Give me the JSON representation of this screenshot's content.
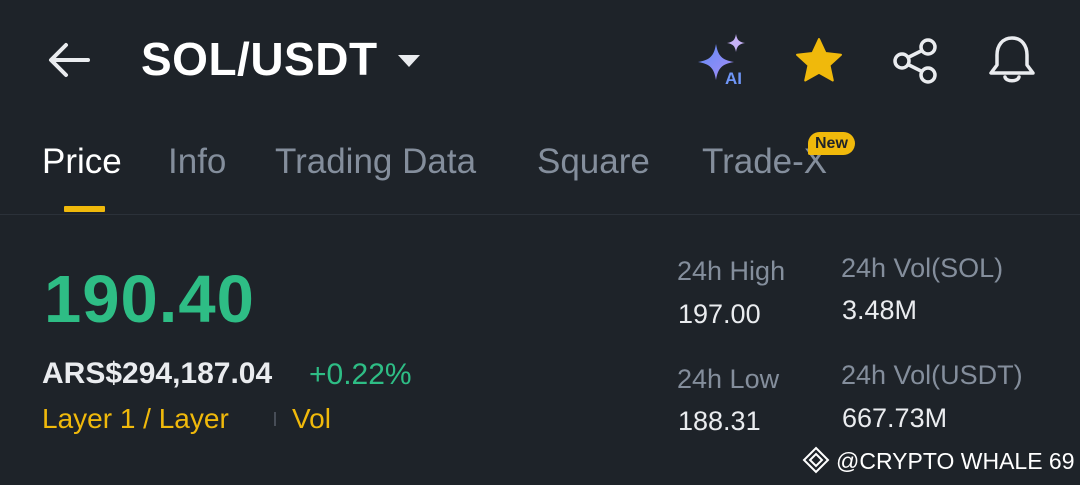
{
  "header": {
    "pair": "SOL/USDT",
    "ai_badge": "AI",
    "icons": [
      "back-arrow-icon",
      "chevron-down-icon",
      "ai-sparkle-icon",
      "star-icon",
      "share-icon",
      "bell-icon"
    ]
  },
  "tabs": [
    {
      "label": "Price",
      "active": true
    },
    {
      "label": "Info",
      "active": false
    },
    {
      "label": "Trading Data",
      "active": false
    },
    {
      "label": "Square",
      "active": false
    },
    {
      "label": "Trade-X",
      "active": false,
      "badge": "New"
    }
  ],
  "price": {
    "last": "190.40",
    "fiat": "ARS$294,187.04",
    "change": "+0.22%",
    "tag_category": "Layer 1 / Layer",
    "tag_vol": "Vol"
  },
  "stats": {
    "high_label": "24h High",
    "high_value": "197.00",
    "low_label": "24h Low",
    "low_value": "188.31",
    "vol_base_label": "24h Vol(SOL)",
    "vol_base_value": "3.48M",
    "vol_quote_label": "24h Vol(USDT)",
    "vol_quote_value": "667.73M"
  },
  "watermark": {
    "text": "@CRYPTO WHALE 69"
  },
  "colors": {
    "background": "#1e2329",
    "accent_yellow": "#f0b90b",
    "up_green": "#2ebd85",
    "muted_text": "#848e9c"
  }
}
